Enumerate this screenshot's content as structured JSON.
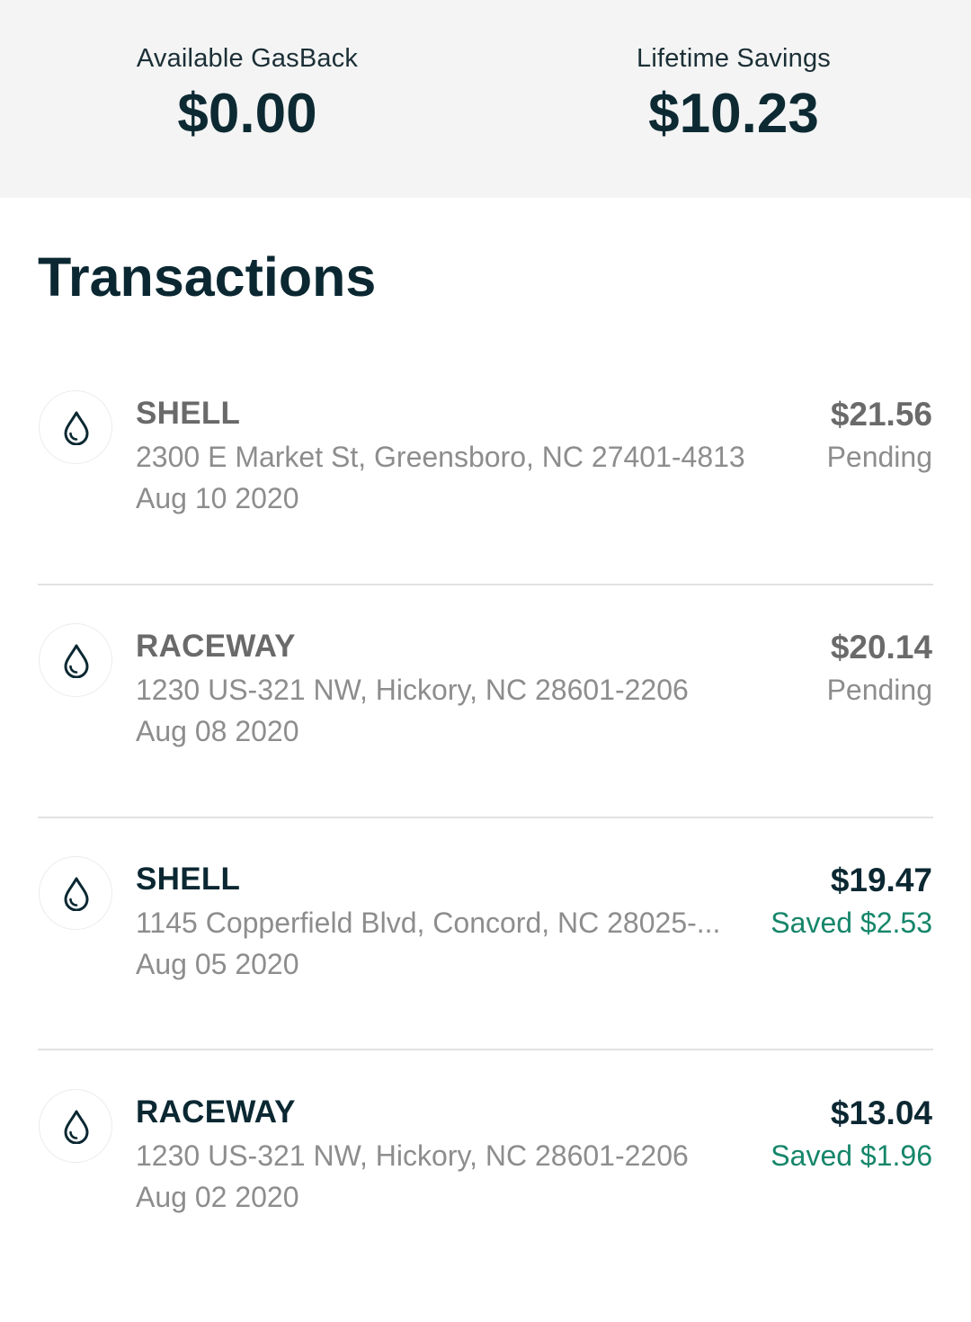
{
  "summary": {
    "available_label": "Available GasBack",
    "available_value": "$0.00",
    "lifetime_label": "Lifetime Savings",
    "lifetime_value": "$10.23"
  },
  "transactions_title": "Transactions",
  "transactions": [
    {
      "icon": "fuel-drop-icon",
      "name": "SHELL",
      "address": "2300 E Market St, Greensboro, NC 27401-4813",
      "date": "Aug 10 2020",
      "amount": "$21.56",
      "status": "Pending"
    },
    {
      "icon": "fuel-drop-icon",
      "name": "RACEWAY",
      "address": "1230 US-321 NW, Hickory, NC 28601-2206",
      "date": "Aug 08 2020",
      "amount": "$20.14",
      "status": "Pending"
    },
    {
      "icon": "fuel-drop-icon",
      "name": "SHELL",
      "address": "1145 Copperfield Blvd, Concord, NC 28025-...",
      "date": "Aug 05 2020",
      "amount": "$19.47",
      "status": "Saved $2.53"
    },
    {
      "icon": "fuel-drop-icon",
      "name": "RACEWAY",
      "address": "1230 US-321 NW, Hickory, NC 28601-2206",
      "date": "Aug 02 2020",
      "amount": "$13.04",
      "status": "Saved $1.96"
    }
  ],
  "colors": {
    "summary_background": "#f4f4f4",
    "primary_text": "#0b2832",
    "pending_text": "#6a6a6a",
    "secondary_text": "#8d8d8d",
    "saved_accent": "#16866a",
    "divider": "#e2e2e2"
  }
}
